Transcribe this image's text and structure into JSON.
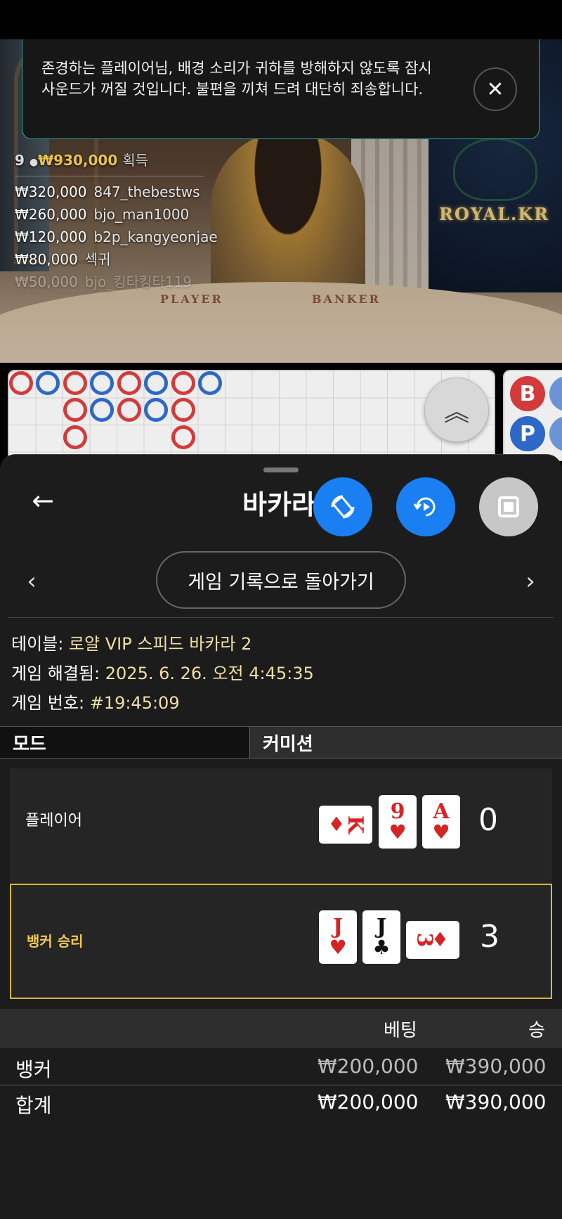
{
  "toast": {
    "message": "존경하는 플레이어님, 배경 소리가 귀하를 방해하지 않도록 잠시 사운드가 꺼질 것입니다. 불편을 끼쳐 드려 대단히 죄송합니다."
  },
  "video": {
    "winner_count": "9",
    "total_won": "₩930,000",
    "won_label": "획득",
    "winners": [
      {
        "amount": "₩320,000",
        "name": "847_thebestws"
      },
      {
        "amount": "₩260,000",
        "name": "bjo_man1000"
      },
      {
        "amount": "₩120,000",
        "name": "b2p_kangyeonjae"
      },
      {
        "amount": "₩80,000",
        "name": "섹귀"
      },
      {
        "amount": "₩50,000",
        "name": "bjo_킹타킹타119"
      }
    ],
    "table_player": "PLAYER",
    "table_banker": "BANKER",
    "brand": "ROYAL.KR"
  },
  "road": {
    "banker_pill": "B",
    "player_pill": "P",
    "beads": [
      "B",
      "P",
      "B",
      "P",
      "B",
      "P",
      "B",
      "P"
    ]
  },
  "sheet": {
    "title": "바카라",
    "history_button": "게임 기록으로 돌아가기",
    "info": {
      "table_label": "테이블:",
      "table_value": "로얄 VIP 스피드 바카라 2",
      "resolved_label": "게임 해결됨:",
      "resolved_value": "2025. 6. 26. 오전 4:45:35",
      "game_no_label": "게임 번호:",
      "game_no_value": "#19:45:09"
    },
    "tabs": {
      "mode": "모드",
      "commission": "커미션"
    },
    "player": {
      "label": "플레이어",
      "score": "0",
      "cards": [
        {
          "rank": "K",
          "suit": "♦"
        },
        {
          "rank": "9",
          "suit": "♥"
        },
        {
          "rank": "A",
          "suit": "♥"
        }
      ]
    },
    "banker": {
      "label": "뱅커 승리",
      "score": "3",
      "cards": [
        {
          "rank": "J",
          "suit": "♥"
        },
        {
          "rank": "J",
          "suit": "♣"
        },
        {
          "rank": "3",
          "suit": "♦"
        }
      ]
    },
    "bets": {
      "col_bet": "베팅",
      "col_win": "승",
      "rows": [
        {
          "name": "뱅커",
          "bet": "₩200,000",
          "win": "₩390,000"
        }
      ],
      "total": {
        "name": "합계",
        "bet": "₩200,000",
        "win": "₩390,000"
      }
    }
  },
  "colors": {
    "accent_blue": "#1a7ff2",
    "banker_red": "#d33b3b",
    "player_blue": "#2d68c8",
    "highlight_gold": "#d9b73a",
    "info_value": "#f2dfa6"
  }
}
